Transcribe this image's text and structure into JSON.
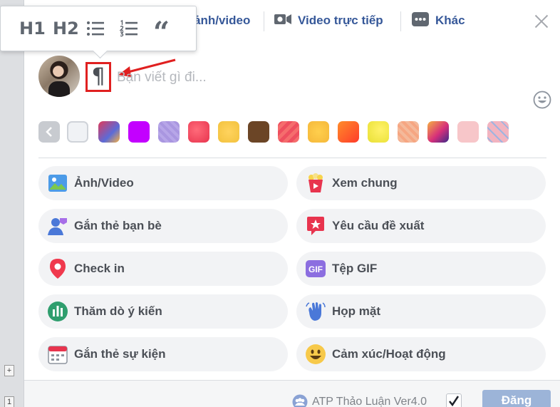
{
  "tabs": {
    "photo_video": "ảnh/video",
    "live_video": "Video trực tiếp",
    "more": "Khác"
  },
  "format_toolbar": {
    "h1": "H1",
    "h2": "H2",
    "bullet_list_icon": "bullet-list-icon",
    "numbered_list_icon": "numbered-list-icon",
    "quote": "“"
  },
  "composer": {
    "format_toggle_glyph": "¶",
    "placeholder": "Bạn viết gì đi..."
  },
  "backgrounds": [
    {
      "color": "#c8cbd0"
    },
    {
      "color": "#f0f2f5"
    },
    {
      "color": "#5b6bd8"
    },
    {
      "color": "#c300ff"
    },
    {
      "color": "#b7a6e8"
    },
    {
      "color": "#e8344e"
    },
    {
      "color": "#f3c23e"
    },
    {
      "color": "#6b4526"
    },
    {
      "color": "#ee4f5f"
    },
    {
      "color": "#f5b83a"
    },
    {
      "color": "#ff5b2a"
    },
    {
      "color": "#e9e034"
    },
    {
      "color": "#f6a682"
    },
    {
      "color": "#d62f7a"
    },
    {
      "color": "#f7c6c9"
    },
    {
      "color": "#f2b4c0"
    }
  ],
  "options": {
    "photo_video": "Ảnh/Video",
    "watch_together": "Xem chung",
    "tag_friends": "Gắn thẻ bạn bè",
    "request_recommendations": "Yêu cầu đề xuất",
    "check_in": "Check in",
    "gif": "Tệp GIF",
    "poll": "Thăm dò ý kiến",
    "meetup": "Họp mặt",
    "tag_event": "Gắn thẻ sự kiện",
    "feeling_activity": "Cảm xúc/Hoạt động"
  },
  "footer": {
    "group_name": "ATP Thảo Luận Ver4.0",
    "post_button": "Đăng"
  },
  "left_strip": {
    "marker1": "+",
    "marker2": "1"
  }
}
